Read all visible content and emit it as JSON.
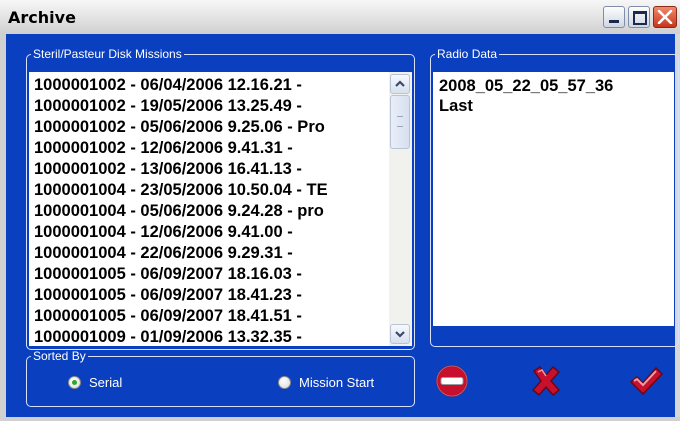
{
  "window": {
    "title": "Archive"
  },
  "missions": {
    "legend": "Steril/Pasteur Disk Missions",
    "items": [
      "1000001002 - 06/04/2006 12.16.21 -",
      "1000001002 - 19/05/2006 13.25.49 -",
      "1000001002 - 05/06/2006 9.25.06 - Pro",
      "1000001002 - 12/06/2006 9.41.31 -",
      "1000001002 - 13/06/2006 16.41.13 -",
      "1000001004 - 23/05/2006 10.50.04 - TE",
      "1000001004 - 05/06/2006 9.24.28 - pro",
      "1000001004 - 12/06/2006 9.41.00 -",
      "1000001004 - 22/06/2006 9.29.31 -",
      "1000001005 - 06/09/2007 18.16.03 -",
      "1000001005 - 06/09/2007 18.41.23 -",
      "1000001005 - 06/09/2007 18.41.51 -",
      "1000001009 - 01/09/2006 13.32.35 -"
    ]
  },
  "radio_data": {
    "legend": "Radio Data",
    "items": [
      "2008_05_22_05_57_36",
      "Last"
    ]
  },
  "sorted_by": {
    "legend": "Sorted By",
    "options": [
      {
        "label": "Serial",
        "checked": true
      },
      {
        "label": "Mission Start",
        "checked": false
      }
    ]
  },
  "actions": {
    "delete_icon": "no-entry-icon",
    "cancel_icon": "cross-icon",
    "ok_icon": "check-icon"
  },
  "colors": {
    "panel": "#0a3fbf",
    "accent_red": "#c8102e"
  }
}
